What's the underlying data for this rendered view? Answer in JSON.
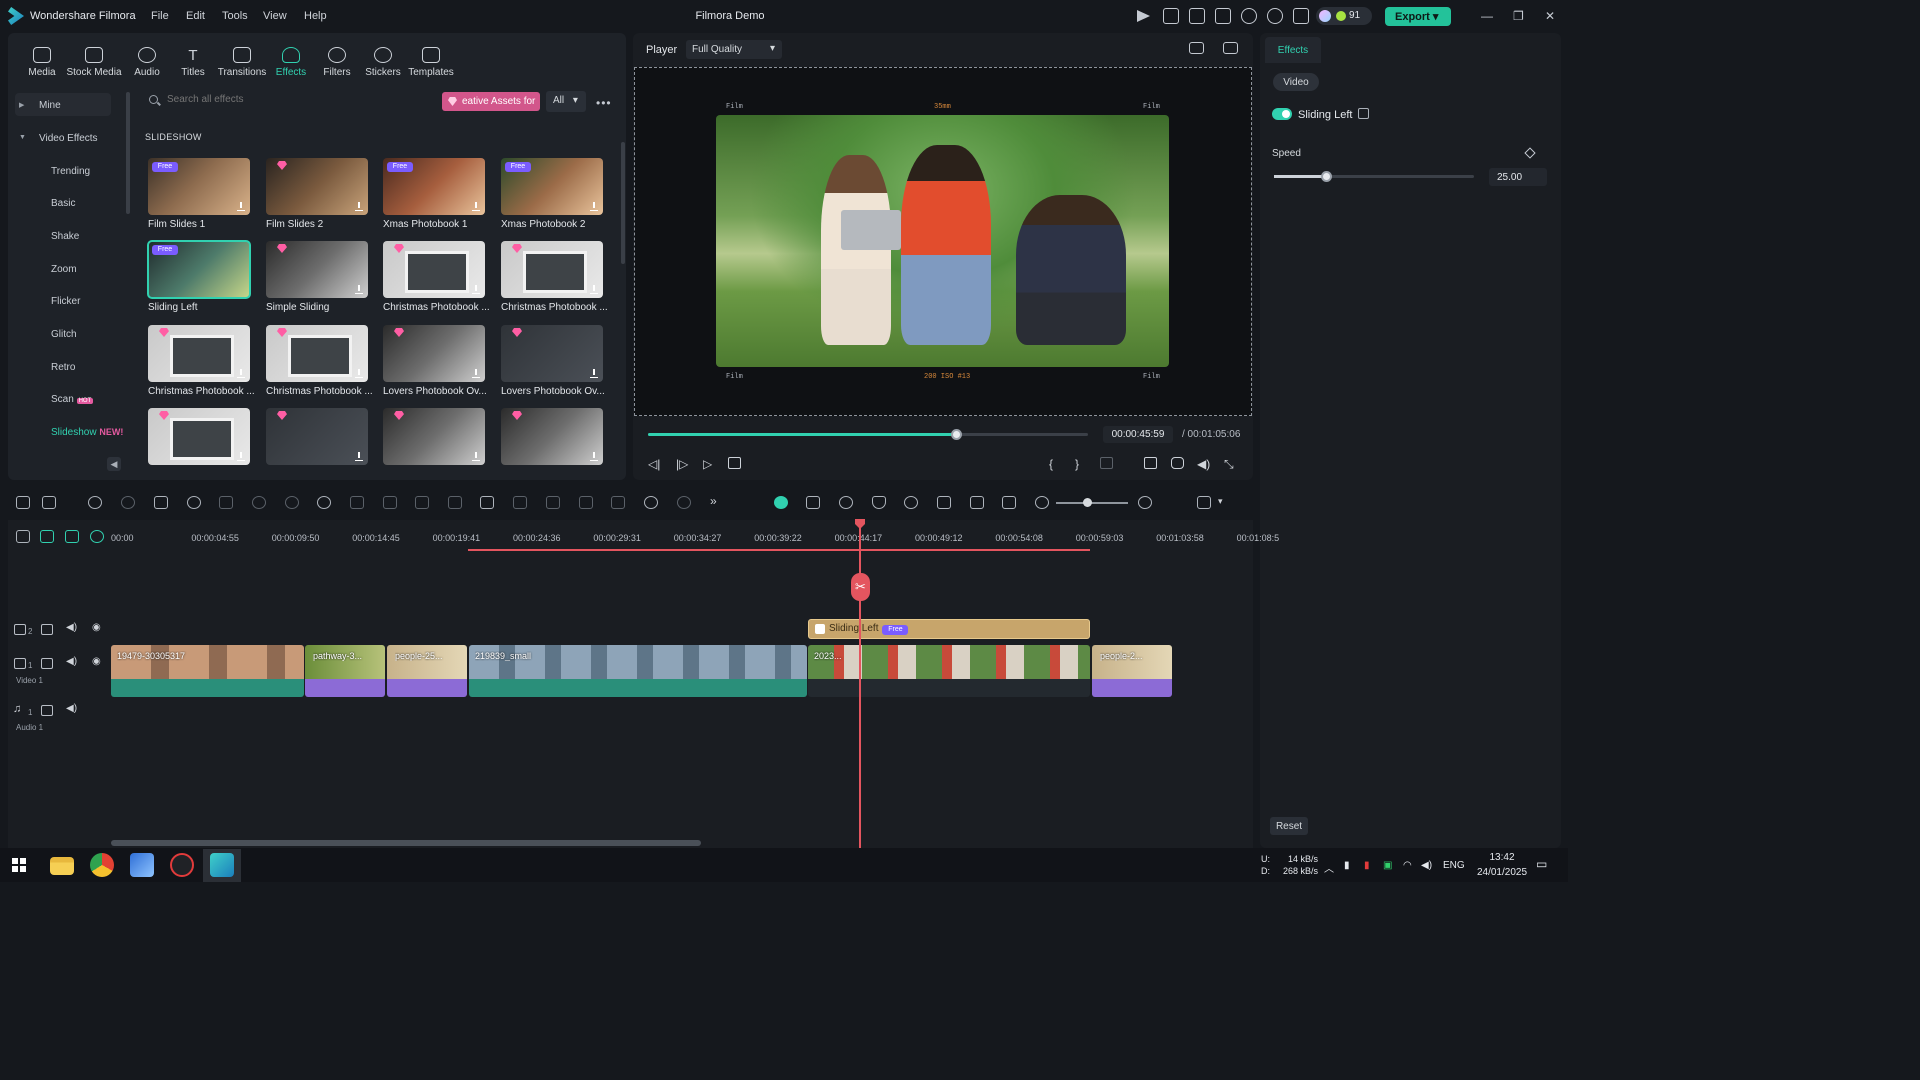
{
  "app": {
    "name": "Wondershare Filmora",
    "project_title": "Filmora Demo",
    "credits": "91",
    "export_label": "Export",
    "menu": [
      "File",
      "Edit",
      "Tools",
      "View",
      "Help"
    ]
  },
  "media_tabs": [
    {
      "label": "Media",
      "icon": "media-icon"
    },
    {
      "label": "Stock Media",
      "icon": "stock-media-icon"
    },
    {
      "label": "Audio",
      "icon": "audio-icon"
    },
    {
      "label": "Titles",
      "icon": "titles-icon"
    },
    {
      "label": "Transitions",
      "icon": "transitions-icon"
    },
    {
      "label": "Effects",
      "icon": "effects-icon",
      "active": true
    },
    {
      "label": "Filters",
      "icon": "filters-icon"
    },
    {
      "label": "Stickers",
      "icon": "stickers-icon"
    },
    {
      "label": "Templates",
      "icon": "templates-icon"
    }
  ],
  "sidebar": {
    "mine": "Mine",
    "video_effects": "Video Effects",
    "items": [
      "Trending",
      "Basic",
      "Shake",
      "Zoom",
      "Flicker",
      "Glitch",
      "Retro",
      "Scan",
      "Slideshow"
    ],
    "scan_badge": "HOT",
    "slideshow_badge": "NEW!"
  },
  "search": {
    "placeholder": "Search all effects",
    "creative_assets": "eative Assets for",
    "filter": "All"
  },
  "section_title": "SLIDESHOW",
  "effects": [
    {
      "label": "Film Slides 1",
      "badge": "Free"
    },
    {
      "label": "Film Slides 2",
      "badge": "gem"
    },
    {
      "label": "Xmas Photobook 1",
      "badge": "Free"
    },
    {
      "label": "Xmas Photobook 2",
      "badge": "Free"
    },
    {
      "label": "Sliding Left",
      "badge": "Free",
      "selected": true
    },
    {
      "label": "Simple Sliding",
      "badge": "gem"
    },
    {
      "label": "Christmas Photobook ...",
      "badge": "gem"
    },
    {
      "label": "Christmas Photobook ...",
      "badge": "gem"
    },
    {
      "label": "Christmas Photobook ...",
      "badge": "gem"
    },
    {
      "label": "Christmas Photobook ...",
      "badge": "gem"
    },
    {
      "label": "Lovers Photobook Ov...",
      "badge": "gem"
    },
    {
      "label": "Lovers Photobook Ov...",
      "badge": "gem"
    },
    {
      "label": "",
      "badge": "gem"
    },
    {
      "label": "",
      "badge": "gem"
    },
    {
      "label": "",
      "badge": "gem"
    },
    {
      "label": "",
      "badge": "gem"
    }
  ],
  "player": {
    "label": "Player",
    "quality": "Full Quality",
    "current_time": "00:00:45:59",
    "total_time": "/ 00:01:05:06",
    "progress": 0.7,
    "film_texts": [
      "Film",
      "Film",
      "Film",
      "Film"
    ],
    "film_top_center": "35mm",
    "film_bottom_center": "200 ISO #13"
  },
  "properties": {
    "tab": "Effects",
    "sub_tab": "Video",
    "effect_name": "Sliding Left",
    "speed_label": "Speed",
    "speed_value": "25.00",
    "speed_fraction": 0.26,
    "reset": "Reset"
  },
  "timeline": {
    "ruler": [
      "00:00",
      "00:00:04:55",
      "00:00:09:50",
      "00:00:14:45",
      "00:00:19:41",
      "00:00:24:36",
      "00:00:29:31",
      "00:00:34:27",
      "00:00:39:22",
      "00:00:44:17",
      "00:00:49:12",
      "00:00:54:08",
      "00:00:59:03",
      "00:01:03:58",
      "00:01:08:5"
    ],
    "tracks": [
      {
        "number": "2",
        "label": ""
      },
      {
        "number": "1",
        "label": "Video 1"
      },
      {
        "number": "1",
        "label": "Audio 1"
      }
    ],
    "effect_clip": {
      "label": "Sliding Left",
      "badge": "Free"
    },
    "clips": [
      "19479-30305317",
      "pathway-3...",
      "people-25...",
      "219839_small",
      "2023...",
      "people-2..."
    ]
  },
  "taskbar": {
    "upload": "14 kB/s",
    "download": "268 kB/s",
    "up_label": "U:",
    "down_label": "D:",
    "lang": "ENG",
    "time": "13:42",
    "date": "24/01/2025"
  },
  "colors": {
    "accent": "#31d1b0",
    "playhead": "#e4555f",
    "effect_clip": "#c7a56b",
    "video_audio": "#2a8f7a",
    "photo_audio": "#8c6bd6"
  }
}
